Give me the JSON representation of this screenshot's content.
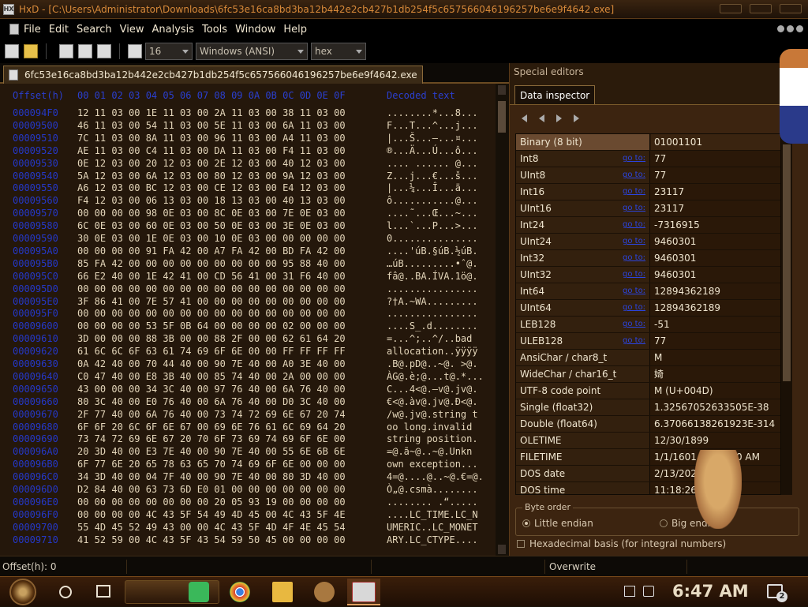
{
  "window": {
    "app": "HxD",
    "title": "HxD - [C:\\Users\\Administrator\\Downloads\\6fc53e16ca8bd3ba12b442e2cb427b1db254f5c657566046196257be6e9f4642.exe]"
  },
  "menu": [
    "File",
    "Edit",
    "Search",
    "View",
    "Analysis",
    "Tools",
    "Window",
    "Help"
  ],
  "toolbar": {
    "bytes_per_row": "16",
    "charset": "Windows (ANSI)",
    "offset_base": "hex"
  },
  "document_tab": "6fc53e16ca8bd3ba12b442e2cb427b1db254f5c657566046196257be6e9f4642.exe",
  "hex_view": {
    "header": {
      "offset": "Offset(h)",
      "columns": "00 01 02 03 04 05 06 07 08 09 0A 0B 0C 0D 0E 0F",
      "decoded": "Decoded text"
    },
    "rows": [
      {
        "offset": "000094F0",
        "bytes": "12 11 03 00 1E 11 03 00 2A 11 03 00 38 11 03 00",
        "text": "........*...8..."
      },
      {
        "offset": "00009500",
        "bytes": "46 11 03 00 54 11 03 00 5E 11 03 00 6A 11 03 00",
        "text": "F...T...^...j..."
      },
      {
        "offset": "00009510",
        "bytes": "7C 11 03 00 8A 11 03 00 96 11 03 00 A4 11 03 00",
        "text": "|...Š...–...¤..."
      },
      {
        "offset": "00009520",
        "bytes": "AE 11 03 00 C4 11 03 00 DA 11 03 00 F4 11 03 00",
        "text": "®...Ä...Ú...ô..."
      },
      {
        "offset": "00009530",
        "bytes": "0E 12 03 00 20 12 03 00 2E 12 03 00 40 12 03 00",
        "text": ".... ...... @..."
      },
      {
        "offset": "00009540",
        "bytes": "5A 12 03 00 6A 12 03 00 80 12 03 00 9A 12 03 00",
        "text": "Z...j...€...š..."
      },
      {
        "offset": "00009550",
        "bytes": "A6 12 03 00 BC 12 03 00 CE 12 03 00 E4 12 03 00",
        "text": "|...¼...Î...ä..."
      },
      {
        "offset": "00009560",
        "bytes": "F4 12 03 00 06 13 03 00 18 13 03 00 40 13 03 00",
        "text": "ô...........@..."
      },
      {
        "offset": "00009570",
        "bytes": "00 00 00 00 98 0E 03 00 8C 0E 03 00 7E 0E 03 00",
        "text": "....˜...Œ...~..."
      },
      {
        "offset": "00009580",
        "bytes": "6C 0E 03 00 60 0E 03 00 50 0E 03 00 3E 0E 03 00",
        "text": "l...`...P...>..."
      },
      {
        "offset": "00009590",
        "bytes": "30 0E 03 00 1E 0E 03 00 10 0E 03 00 00 00 00 00",
        "text": "0..............."
      },
      {
        "offset": "000095A0",
        "bytes": "00 00 00 00 91 FA 42 00 A7 FA 42 00 BD FA 42 00",
        "text": "....'úB.§úB.½úB."
      },
      {
        "offset": "000095B0",
        "bytes": "85 FA 42 00 00 00 00 00 00 00 00 00 95 88 40 00",
        "text": "…úB.........•ˆ@."
      },
      {
        "offset": "000095C0",
        "bytes": "66 E2 40 00 1E 42 41 00 CD 56 41 00 31 F6 40 00",
        "text": "fâ@..BA.ÍVA.1ö@."
      },
      {
        "offset": "000095D0",
        "bytes": "00 00 00 00 00 00 00 00 00 00 00 00 00 00 00 00",
        "text": "................"
      },
      {
        "offset": "000095E0",
        "bytes": "3F 86 41 00 7E 57 41 00 00 00 00 00 00 00 00 00",
        "text": "?†A.~WA........."
      },
      {
        "offset": "000095F0",
        "bytes": "00 00 00 00 00 00 00 00 00 00 00 00 00 00 00 00",
        "text": "................"
      },
      {
        "offset": "00009600",
        "bytes": "00 00 00 00 53 5F 0B 64 00 00 00 00 02 00 00 00",
        "text": "....S_.d........"
      },
      {
        "offset": "00009610",
        "bytes": "3D 00 00 00 88 3B 00 00 88 2F 00 00 62 61 64 20",
        "text": "=...^;..^/..bad "
      },
      {
        "offset": "00009620",
        "bytes": "61 6C 6C 6F 63 61 74 69 6F 6E 00 00 FF FF FF FF",
        "text": "allocation..ÿÿÿÿ"
      },
      {
        "offset": "00009630",
        "bytes": "0A 42 40 00 70 44 40 00 90 7E 40 00 A0 3E 40 00",
        "text": ".B@.pD@..~@. >@."
      },
      {
        "offset": "00009640",
        "bytes": "C0 47 40 00 E8 3B 40 00 85 74 40 00 2A 00 00 00",
        "text": "ÀG@.è;@...t@.*..."
      },
      {
        "offset": "00009650",
        "bytes": "43 00 00 00 34 3C 40 00 97 76 40 00 6A 76 40 00",
        "text": "C...4<@.—v@.jv@."
      },
      {
        "offset": "00009660",
        "bytes": "80 3C 40 00 E0 76 40 00 6A 76 40 00 D0 3C 40 00",
        "text": "€<@.àv@.jv@.Ð<@."
      },
      {
        "offset": "00009670",
        "bytes": "2F 77 40 00 6A 76 40 00 73 74 72 69 6E 67 20 74",
        "text": "/w@.jv@.string t"
      },
      {
        "offset": "00009680",
        "bytes": "6F 6F 20 6C 6F 6E 67 00 69 6E 76 61 6C 69 64 20",
        "text": "oo long.invalid "
      },
      {
        "offset": "00009690",
        "bytes": "73 74 72 69 6E 67 20 70 6F 73 69 74 69 6F 6E 00",
        "text": "string position."
      },
      {
        "offset": "000096A0",
        "bytes": "20 3D 40 00 E3 7E 40 00 90 7E 40 00 55 6E 6B 6E",
        "text": " =@.ã~@..~@.Unkn"
      },
      {
        "offset": "000096B0",
        "bytes": "6F 77 6E 20 65 78 63 65 70 74 69 6F 6E 00 00 00",
        "text": "own exception..."
      },
      {
        "offset": "000096C0",
        "bytes": "34 3D 40 00 04 7F 40 00 90 7E 40 00 80 3D 40 00",
        "text": "4=@....@..~@.€=@."
      },
      {
        "offset": "000096D0",
        "bytes": "D2 84 40 00 63 73 6D E0 01 00 00 00 00 00 00 00",
        "text": "Ò„@.csmà........"
      },
      {
        "offset": "000096E0",
        "bytes": "00 00 00 00 00 00 00 00 20 05 93 19 00 00 00 00",
        "text": "........ .“....."
      },
      {
        "offset": "000096F0",
        "bytes": "00 00 00 00 4C 43 5F 54 49 4D 45 00 4C 43 5F 4E",
        "text": "....LC_TIME.LC_N"
      },
      {
        "offset": "00009700",
        "bytes": "55 4D 45 52 49 43 00 00 4C 43 5F 4D 4F 4E 45 54",
        "text": "UMERIC..LC_MONET"
      },
      {
        "offset": "00009710",
        "bytes": "41 52 59 00 4C 43 5F 43 54 59 50 45 00 00 00 00",
        "text": "ARY.LC_CTYPE...."
      }
    ]
  },
  "side_panel": {
    "title": "Special editors",
    "tab": "Data inspector",
    "goto_label": "go to:",
    "rows": [
      {
        "name": "Binary (8 bit)",
        "value": "01001101",
        "goto": false,
        "selected": true
      },
      {
        "name": "Int8",
        "value": "77",
        "goto": true
      },
      {
        "name": "UInt8",
        "value": "77",
        "goto": true
      },
      {
        "name": "Int16",
        "value": "23117",
        "goto": true
      },
      {
        "name": "UInt16",
        "value": "23117",
        "goto": true
      },
      {
        "name": "Int24",
        "value": "-7316915",
        "goto": true
      },
      {
        "name": "UInt24",
        "value": "9460301",
        "goto": true
      },
      {
        "name": "Int32",
        "value": "9460301",
        "goto": true
      },
      {
        "name": "UInt32",
        "value": "9460301",
        "goto": true
      },
      {
        "name": "Int64",
        "value": "12894362189",
        "goto": true
      },
      {
        "name": "UInt64",
        "value": "12894362189",
        "goto": true
      },
      {
        "name": "LEB128",
        "value": "-51",
        "goto": true
      },
      {
        "name": "ULEB128",
        "value": "77",
        "goto": true
      },
      {
        "name": "AnsiChar / char8_t",
        "value": "M",
        "goto": false
      },
      {
        "name": "WideChar / char16_t",
        "value": "婍",
        "goto": false
      },
      {
        "name": "UTF-8 code point",
        "value": "M (U+004D)",
        "goto": false
      },
      {
        "name": "Single (float32)",
        "value": "1.32567052633505E-38",
        "goto": false
      },
      {
        "name": "Double (float64)",
        "value": "6.37066138261923E-314",
        "goto": false
      },
      {
        "name": "OLETIME",
        "value": "12/30/1899",
        "goto": false
      },
      {
        "name": "FILETIME",
        "value": "1/1/1601 12:00:00 AM",
        "goto": false
      },
      {
        "name": "DOS date",
        "value": "2/13/2020",
        "goto": false
      },
      {
        "name": "DOS time",
        "value": "11:18:26 AM",
        "goto": false
      }
    ],
    "byte_order": {
      "legend": "Byte order",
      "little": "Little endian",
      "big": "Big endian"
    },
    "hex_basis": "Hexadecimal basis (for integral numbers)"
  },
  "status": {
    "offset": "Offset(h): 0",
    "mode": "Overwrite"
  },
  "taskbar": {
    "time": "6:47 AM",
    "notifications": "2"
  },
  "colors": {
    "accent": "#d88a3a",
    "offset_blue": "#2438c8",
    "panel_brown": "#3c2410"
  }
}
